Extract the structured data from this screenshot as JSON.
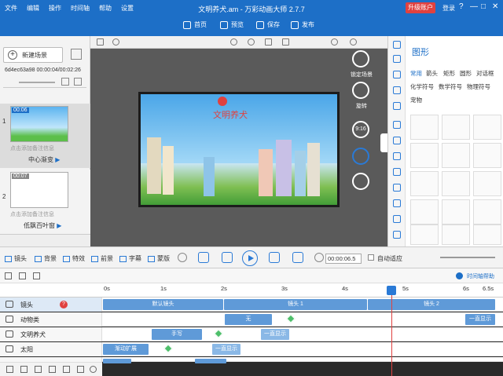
{
  "app": {
    "title": "文明养犬.am - 万彩动画大师 2.7.7",
    "menu": [
      "文件",
      "编辑",
      "操作",
      "时间轴",
      "帮助",
      "设置"
    ],
    "upgrade_label": "升级账户",
    "login_label": "登录",
    "window_controls": [
      "?",
      "—",
      "□",
      "✕"
    ]
  },
  "toolbar": {
    "buttons": [
      {
        "label": "首页",
        "icon": "home-icon"
      },
      {
        "label": "预览",
        "icon": "preview-icon"
      },
      {
        "label": "保存",
        "icon": "save-icon"
      },
      {
        "label": "发布",
        "icon": "publish-icon"
      }
    ]
  },
  "scenes": {
    "new_scene_label": "新建场景",
    "timecode": "6d4ec63a98  00:00:04/00:02:26",
    "list": [
      {
        "index": "1",
        "duration": "00:06",
        "note_placeholder": "点击添加备注信息",
        "transition": "中心渐变"
      },
      {
        "index": "2",
        "duration": "00:07",
        "note_placeholder": "点击添加备注信息",
        "transition": "低飘百叶窗"
      }
    ]
  },
  "canvas": {
    "text_overlay": "文明养犬",
    "side_tools": [
      {
        "label": "锁定场景",
        "icon": "lock-icon"
      },
      {
        "label": "旋转",
        "icon": "rotate-icon"
      },
      {
        "label": "9:16",
        "icon": "ratio-icon"
      },
      {
        "label": "",
        "icon": "camera-icon"
      },
      {
        "label": "",
        "icon": "pen-icon"
      }
    ]
  },
  "right_panel": {
    "title": "图形",
    "tabs": [
      "常用",
      "箭头",
      "矩形",
      "圆形",
      "对话框",
      "化学符号",
      "数学符号",
      "物理符号",
      "宠物"
    ]
  },
  "object_bar": {
    "items": [
      "镜头",
      "背景",
      "特效",
      "前景",
      "字幕",
      "蒙版"
    ],
    "time_value": "00:00:06.5",
    "follow_label": "自动适应"
  },
  "timeline": {
    "help_label": "时间轴帮助",
    "ticks": [
      "0s",
      "1s",
      "2s",
      "3s",
      "4s",
      "5s",
      "6s",
      "6.5s"
    ],
    "tracks": [
      {
        "name": "镜头",
        "bars": [
          {
            "label": "默认镜头"
          },
          {
            "label": "镜头 1"
          },
          {
            "label": "镜头 2"
          }
        ]
      },
      {
        "name": "动物类",
        "bars": [
          {
            "label": "无"
          },
          {
            "label": "一直显示"
          }
        ]
      },
      {
        "name": "文明养犬",
        "bars": [
          {
            "label": "手写"
          },
          {
            "label": "一直显示"
          }
        ]
      },
      {
        "name": "太阳",
        "bars": [
          {
            "label": "渐动扩展"
          },
          {
            "label": "一直显示"
          }
        ]
      },
      {
        "name": "",
        "bars": []
      }
    ]
  },
  "colors": {
    "brand_blue": "#1d6fc7",
    "upgrade_red": "#e0413f",
    "bar_blue": "#5f9ad8",
    "keyframe_green": "#4dbf6a"
  }
}
